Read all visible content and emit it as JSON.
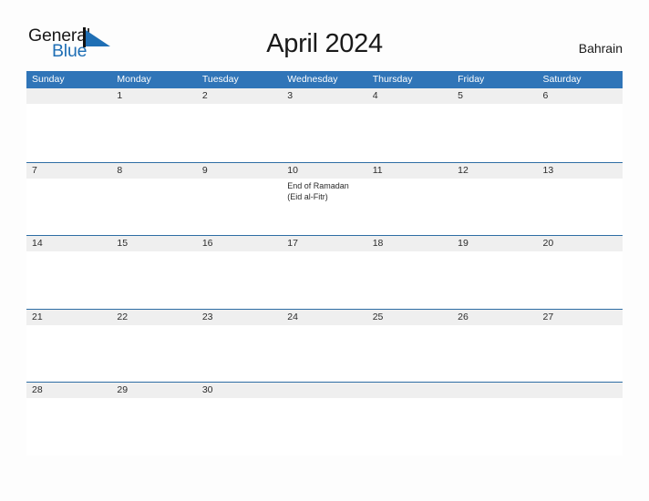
{
  "brand": {
    "name_part1": "General",
    "name_part2": "Blue",
    "flag_icon": "blue-triangle-flag-icon",
    "color_dark": "#1a1a1a",
    "color_blue": "#1f6fb5"
  },
  "header": {
    "title": "April 2024",
    "country": "Bahrain"
  },
  "colors": {
    "header_blue": "#3075b8",
    "row_rule_blue": "#2e6da4",
    "date_band_gray": "#efefef",
    "page_background": "#fdfdfd"
  },
  "calendar": {
    "month": "April",
    "year": "2024",
    "weekday_headers": [
      "Sunday",
      "Monday",
      "Tuesday",
      "Wednesday",
      "Thursday",
      "Friday",
      "Saturday"
    ],
    "weeks": [
      [
        {
          "date": "",
          "events": []
        },
        {
          "date": "1",
          "events": []
        },
        {
          "date": "2",
          "events": []
        },
        {
          "date": "3",
          "events": []
        },
        {
          "date": "4",
          "events": []
        },
        {
          "date": "5",
          "events": []
        },
        {
          "date": "6",
          "events": []
        }
      ],
      [
        {
          "date": "7",
          "events": []
        },
        {
          "date": "8",
          "events": []
        },
        {
          "date": "9",
          "events": []
        },
        {
          "date": "10",
          "events": [
            "End of Ramadan",
            "(Eid al-Fitr)"
          ]
        },
        {
          "date": "11",
          "events": []
        },
        {
          "date": "12",
          "events": []
        },
        {
          "date": "13",
          "events": []
        }
      ],
      [
        {
          "date": "14",
          "events": []
        },
        {
          "date": "15",
          "events": []
        },
        {
          "date": "16",
          "events": []
        },
        {
          "date": "17",
          "events": []
        },
        {
          "date": "18",
          "events": []
        },
        {
          "date": "19",
          "events": []
        },
        {
          "date": "20",
          "events": []
        }
      ],
      [
        {
          "date": "21",
          "events": []
        },
        {
          "date": "22",
          "events": []
        },
        {
          "date": "23",
          "events": []
        },
        {
          "date": "24",
          "events": []
        },
        {
          "date": "25",
          "events": []
        },
        {
          "date": "26",
          "events": []
        },
        {
          "date": "27",
          "events": []
        }
      ],
      [
        {
          "date": "28",
          "events": []
        },
        {
          "date": "29",
          "events": []
        },
        {
          "date": "30",
          "events": []
        },
        {
          "date": "",
          "events": []
        },
        {
          "date": "",
          "events": []
        },
        {
          "date": "",
          "events": []
        },
        {
          "date": "",
          "events": []
        }
      ]
    ]
  }
}
